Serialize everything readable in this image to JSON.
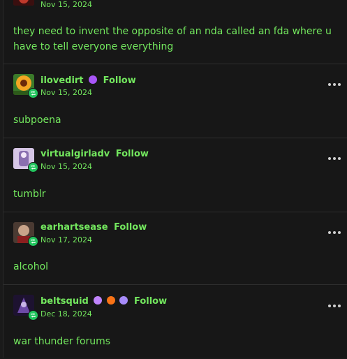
{
  "posts": [
    {
      "date": "Nov 15, 2024",
      "text": "they need to invent the opposite of an nda called an fda where u have to tell everyone everything"
    },
    {
      "username": "ilovedirt",
      "follow": "Follow",
      "date": "Nov 15, 2024",
      "text": "subpoena"
    },
    {
      "username": "virtualgirladv",
      "follow": "Follow",
      "date": "Nov 15, 2024",
      "text": "tumblr"
    },
    {
      "username": "earhartsease",
      "follow": "Follow",
      "date": "Nov 17, 2024",
      "text": "alcohol"
    },
    {
      "username": "beltsquid",
      "follow": "Follow",
      "date": "Dec 18, 2024",
      "text": "war thunder forums"
    }
  ],
  "colors": {
    "accent": "#73e75e",
    "background": "#171717",
    "badge": "#22c55e"
  },
  "icons": [
    "reblog-badge-icon",
    "more-options-icon",
    "sparkle-emoji-icon",
    "pawprint-emoji-icon"
  ]
}
